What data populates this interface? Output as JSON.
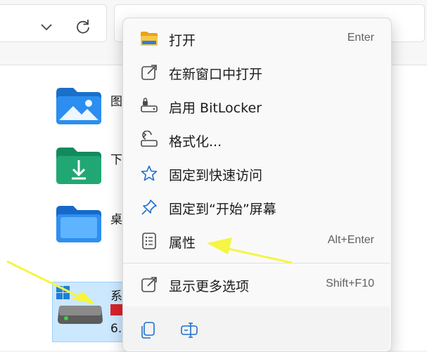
{
  "explorer": {
    "folders": [
      {
        "name": "图",
        "icon": "pictures-folder-icon"
      },
      {
        "name": "下",
        "icon": "downloads-folder-icon"
      },
      {
        "name": "桌",
        "icon": "desktop-folder-icon"
      }
    ],
    "drive": {
      "name": "系",
      "size": "6.",
      "icon": "windows-drive-icon"
    }
  },
  "menu": {
    "items": [
      {
        "label": "打开",
        "accelerator": "Enter",
        "icon": "folder-icon"
      },
      {
        "label": "在新窗口中打开",
        "icon": "open-new-window-icon"
      },
      {
        "label": "启用 BitLocker",
        "icon": "bitlocker-lock-icon"
      },
      {
        "label": "格式化...",
        "icon": "format-drive-icon"
      },
      {
        "label": "固定到快速访问",
        "icon": "star-icon"
      },
      {
        "label": "固定到“开始”屏幕",
        "icon": "pin-icon"
      },
      {
        "label": "属性",
        "accelerator": "Alt+Enter",
        "icon": "properties-icon"
      },
      {
        "label": "显示更多选项",
        "accelerator": "Shift+F10",
        "icon": "show-more-options-icon"
      }
    ],
    "bottom_icons": [
      "copy-icon",
      "rename-icon"
    ]
  },
  "colors": {
    "accent": "#0067c0",
    "arrow": "#f5f542",
    "drive_bar": "#d9222a",
    "selection": "#cce8ff"
  }
}
